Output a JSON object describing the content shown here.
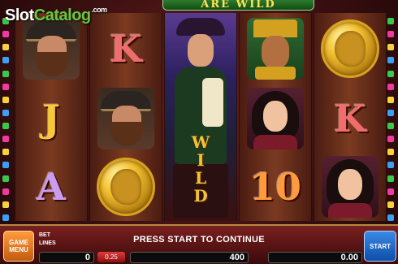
{
  "banner": {
    "text": "ARE WILD"
  },
  "logo": {
    "part1": "Slot",
    "part2": "Catalog",
    "suffix": ".com"
  },
  "reels": {
    "symbols": [
      [
        "pirate",
        "J",
        "A"
      ],
      [
        "K",
        "pirate",
        "coin"
      ],
      [
        "wild"
      ],
      [
        "aztec",
        "lady",
        "10"
      ],
      [
        "coin",
        "K",
        "lady"
      ]
    ],
    "wild_label": "WILD"
  },
  "letter_colors": {
    "J": "#f7c83a",
    "A": "#c99cf0",
    "K": "#f06d6d",
    "10": "#ff9b3a"
  },
  "lights": {
    "colors": [
      "#3ac84a",
      "#f03aa0",
      "#f7d23a",
      "#3aa0f7"
    ]
  },
  "controls": {
    "menu_label_1": "GAME",
    "menu_label_2": "MENU",
    "bet_label": "BET",
    "lines_label": "LINES",
    "message": "PRESS START TO CONTINUE",
    "bet_value": "0",
    "coin_value": "0.25",
    "credit_value": "400",
    "win_value": "0.00",
    "start_label": "START"
  }
}
